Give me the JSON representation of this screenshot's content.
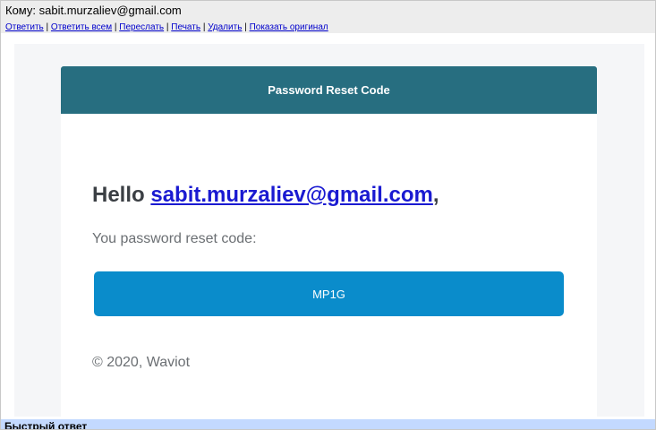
{
  "header": {
    "to_label": "Кому:",
    "to_address": "sabit.murzaliev@gmail.com"
  },
  "actions": {
    "reply": "Ответить",
    "reply_all": "Ответить всем",
    "forward": "Переслать",
    "print": "Печать",
    "delete": "Удалить",
    "show_original": "Показать оригинал",
    "separator": "|"
  },
  "email": {
    "banner_title": "Password Reset Code",
    "greeting_prefix": "Hello",
    "greeting_email": "sabit.murzaliev@gmail.com",
    "greeting_suffix": ",",
    "reset_text": "You password reset code:",
    "code": "MP1G",
    "copyright": "© 2020, Waviot"
  },
  "quick_reply": {
    "label": "Быстрый ответ"
  },
  "colors": {
    "banner": "#276e80",
    "code_box": "#0a8ccb",
    "link": "#1a1ad1",
    "quick_reply_bar": "#c3d9ff"
  }
}
